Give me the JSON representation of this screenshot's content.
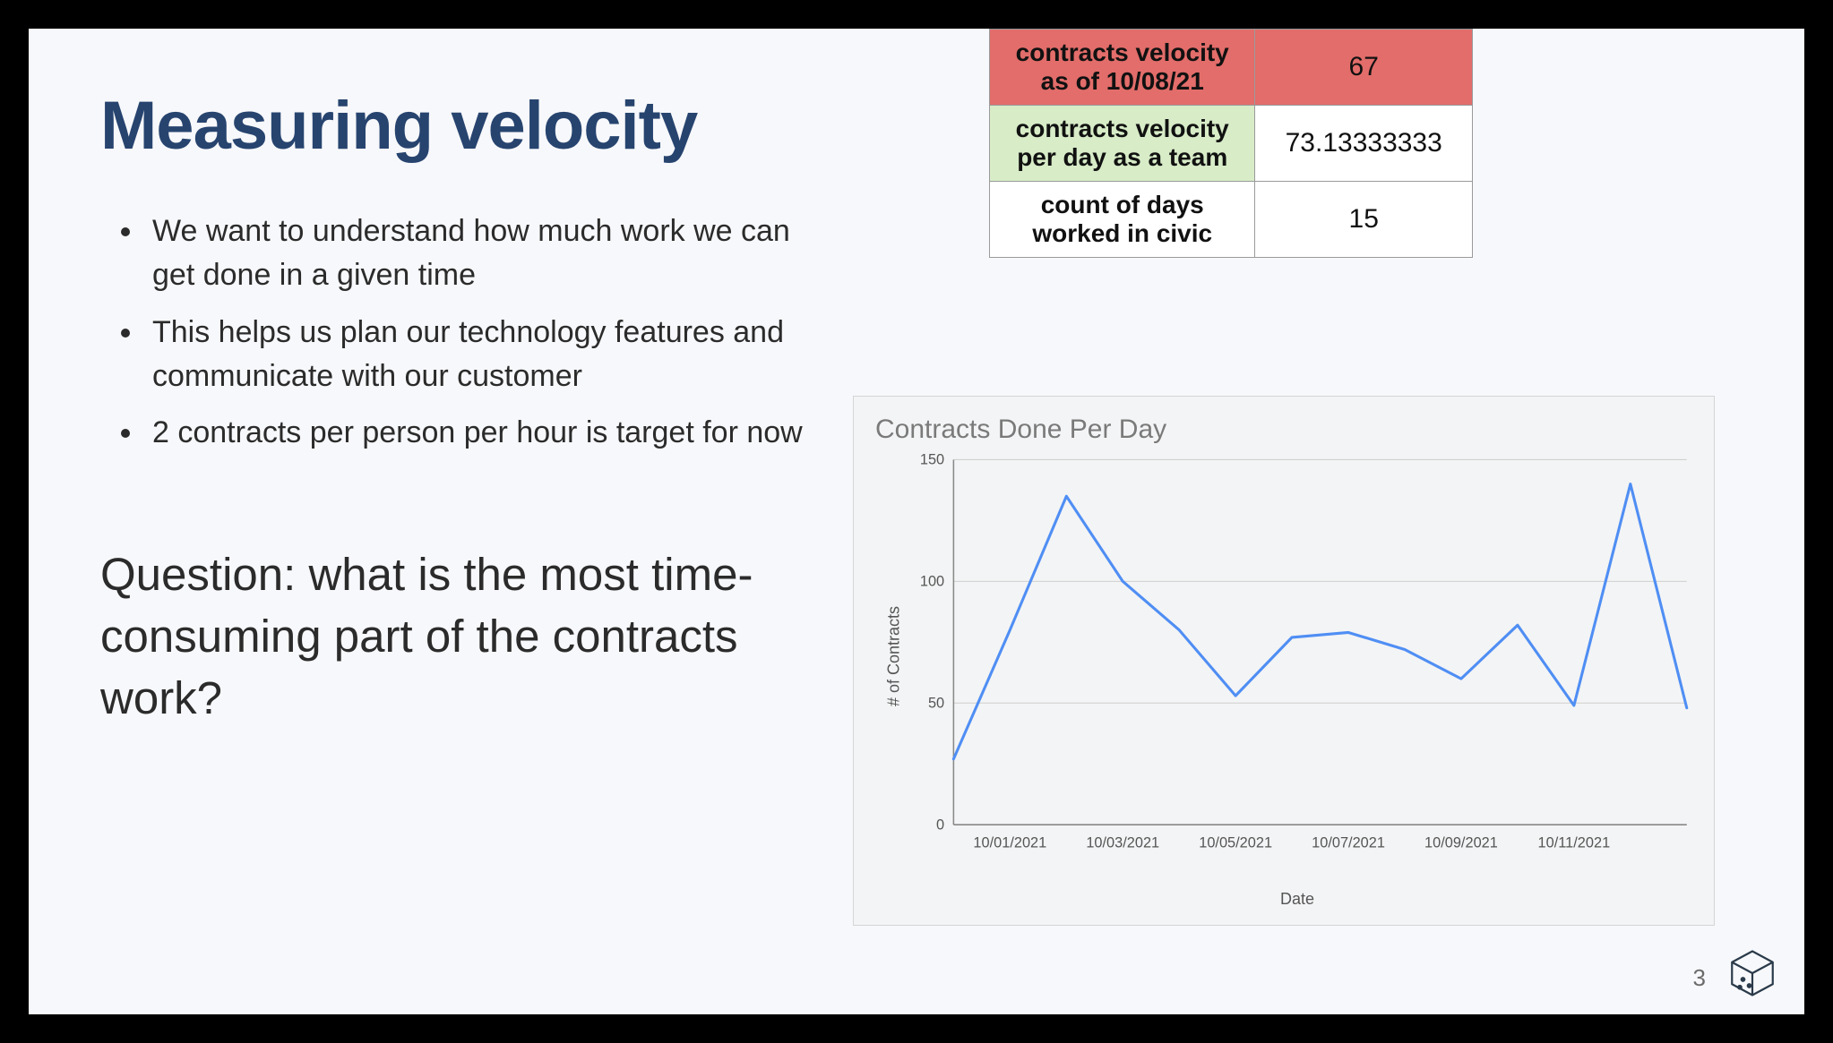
{
  "title": "Measuring velocity",
  "bullets": [
    "We want to understand how much work we can get done in a given time",
    "This helps us plan our technology features and communicate with our customer",
    "2 contracts per person per hour is target for now"
  ],
  "question": "Question: what is the most time-consuming part of the contracts work?",
  "metrics": {
    "rows": [
      {
        "label": "contracts velocity as of 10/08/21",
        "value": "67",
        "style": "red"
      },
      {
        "label": "contracts velocity per day as a team",
        "value": "73.13333333",
        "style": "green"
      },
      {
        "label": "count of days worked in civic",
        "value": "15",
        "style": "plain"
      }
    ]
  },
  "chart_data": {
    "type": "line",
    "title": "Contracts Done Per Day",
    "xlabel": "Date",
    "ylabel": "# of Contracts",
    "ylim": [
      0,
      150
    ],
    "yticks": [
      0,
      50,
      100,
      150
    ],
    "x": [
      "09/30/2021",
      "10/01/2021",
      "10/02/2021",
      "10/03/2021",
      "10/04/2021",
      "10/05/2021",
      "10/06/2021",
      "10/07/2021",
      "10/08/2021",
      "10/09/2021",
      "10/10/2021",
      "10/11/2021",
      "10/12/2021",
      "10/13/2021"
    ],
    "xticks": [
      "10/01/2021",
      "10/03/2021",
      "10/05/2021",
      "10/07/2021",
      "10/09/2021",
      "10/11/2021"
    ],
    "values": [
      27,
      80,
      135,
      100,
      80,
      53,
      77,
      79,
      72,
      60,
      82,
      49,
      140,
      48
    ]
  },
  "page_number": "3"
}
